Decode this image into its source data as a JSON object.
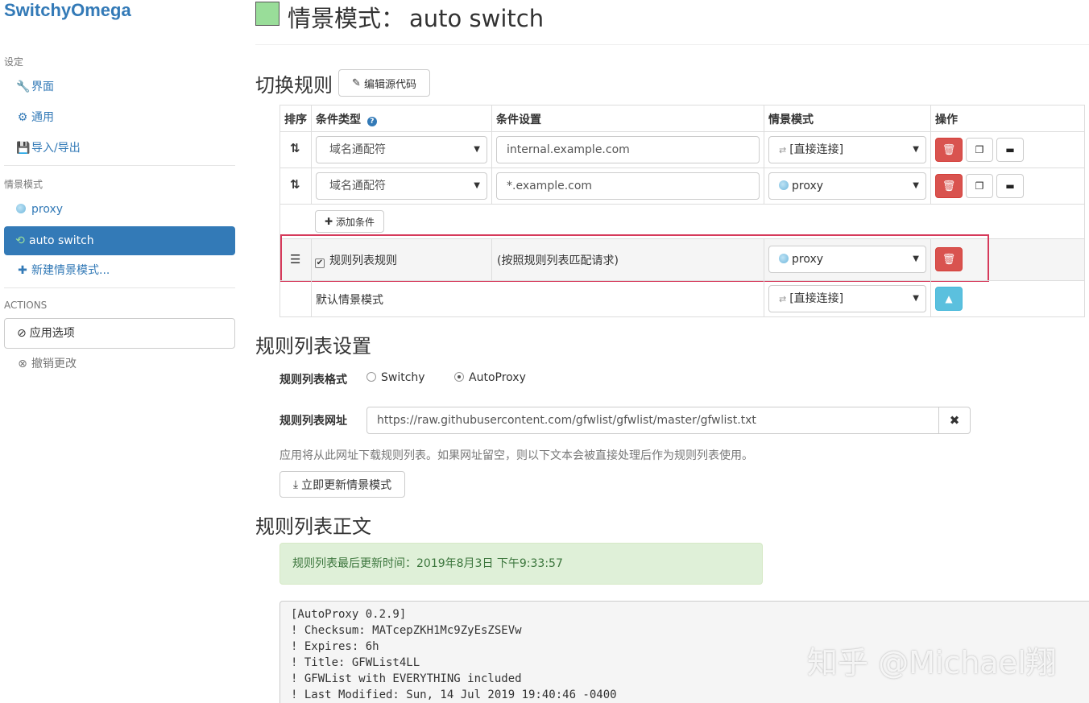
{
  "sidebar": {
    "brand": "SwitchyOmega",
    "settings_header": "设定",
    "settings_items": [
      {
        "label": "界面",
        "icon": "wrench-icon"
      },
      {
        "label": "通用",
        "icon": "gear-icon"
      },
      {
        "label": "导入/导出",
        "icon": "floppy-icon"
      }
    ],
    "profiles_header": "情景模式",
    "profiles": [
      {
        "label": "proxy",
        "icon": "globe-icon"
      },
      {
        "label": "auto switch",
        "icon": "switch-icon",
        "active": true
      },
      {
        "label": "新建情景模式...",
        "icon": "plus-icon"
      }
    ],
    "actions_header": "ACTIONS",
    "apply_label": "应用选项",
    "discard_label": "撤销更改"
  },
  "header": {
    "title_prefix": "情景模式：",
    "profile_name": "auto switch",
    "swatch_color": "#99dd99"
  },
  "rules": {
    "section_title": "切换规则",
    "edit_source_label": "编辑源代码",
    "columns": [
      "排序",
      "条件类型",
      "条件设置",
      "情景模式",
      "操作"
    ],
    "rows": [
      {
        "type": "域名通配符",
        "pattern": "internal.example.com",
        "profile": "[直接连接]"
      },
      {
        "type": "域名通配符",
        "pattern": "*.example.com",
        "profile": "proxy"
      }
    ],
    "add_condition_label": "添加条件",
    "rule_list_row": {
      "label": "规则列表规则",
      "setting": "(按照规则列表匹配请求)",
      "profile": "proxy"
    },
    "default_row": {
      "label": "默认情景模式",
      "profile": "[直接连接]"
    }
  },
  "rule_list_settings": {
    "section_title": "规则列表设置",
    "format_label": "规则列表格式",
    "format_options": [
      "Switchy",
      "AutoProxy"
    ],
    "format_selected": "AutoProxy",
    "url_label": "规则列表网址",
    "url_value": "https://raw.githubusercontent.com/gfwlist/gfwlist/master/gfwlist.txt",
    "help_text": "应用将从此网址下载规则列表。如果网址留空，则以下文本会被直接处理后作为规则列表使用。",
    "update_button_label": "立即更新情景模式"
  },
  "rule_list_text": {
    "section_title": "规则列表正文",
    "last_updated": "规则列表最后更新时间：2019年8月3日 下午9:33:57",
    "lines": [
      "[AutoProxy 0.2.9]",
      "! Checksum: MATcepZKH1Mc9ZyEsZSEVw",
      "! Expires: 6h",
      "! Title: GFWList4LL",
      "! GFWList with EVERYTHING included",
      "! Last Modified: Sun, 14 Jul 2019 19:40:46 -0400"
    ]
  },
  "watermark": "知乎 @Michael翔",
  "colors": {
    "primary": "#337ab7",
    "danger": "#d9534f",
    "info": "#5bc0de",
    "highlight_border": "#d63a5b",
    "success_bg": "#dff0d8"
  }
}
